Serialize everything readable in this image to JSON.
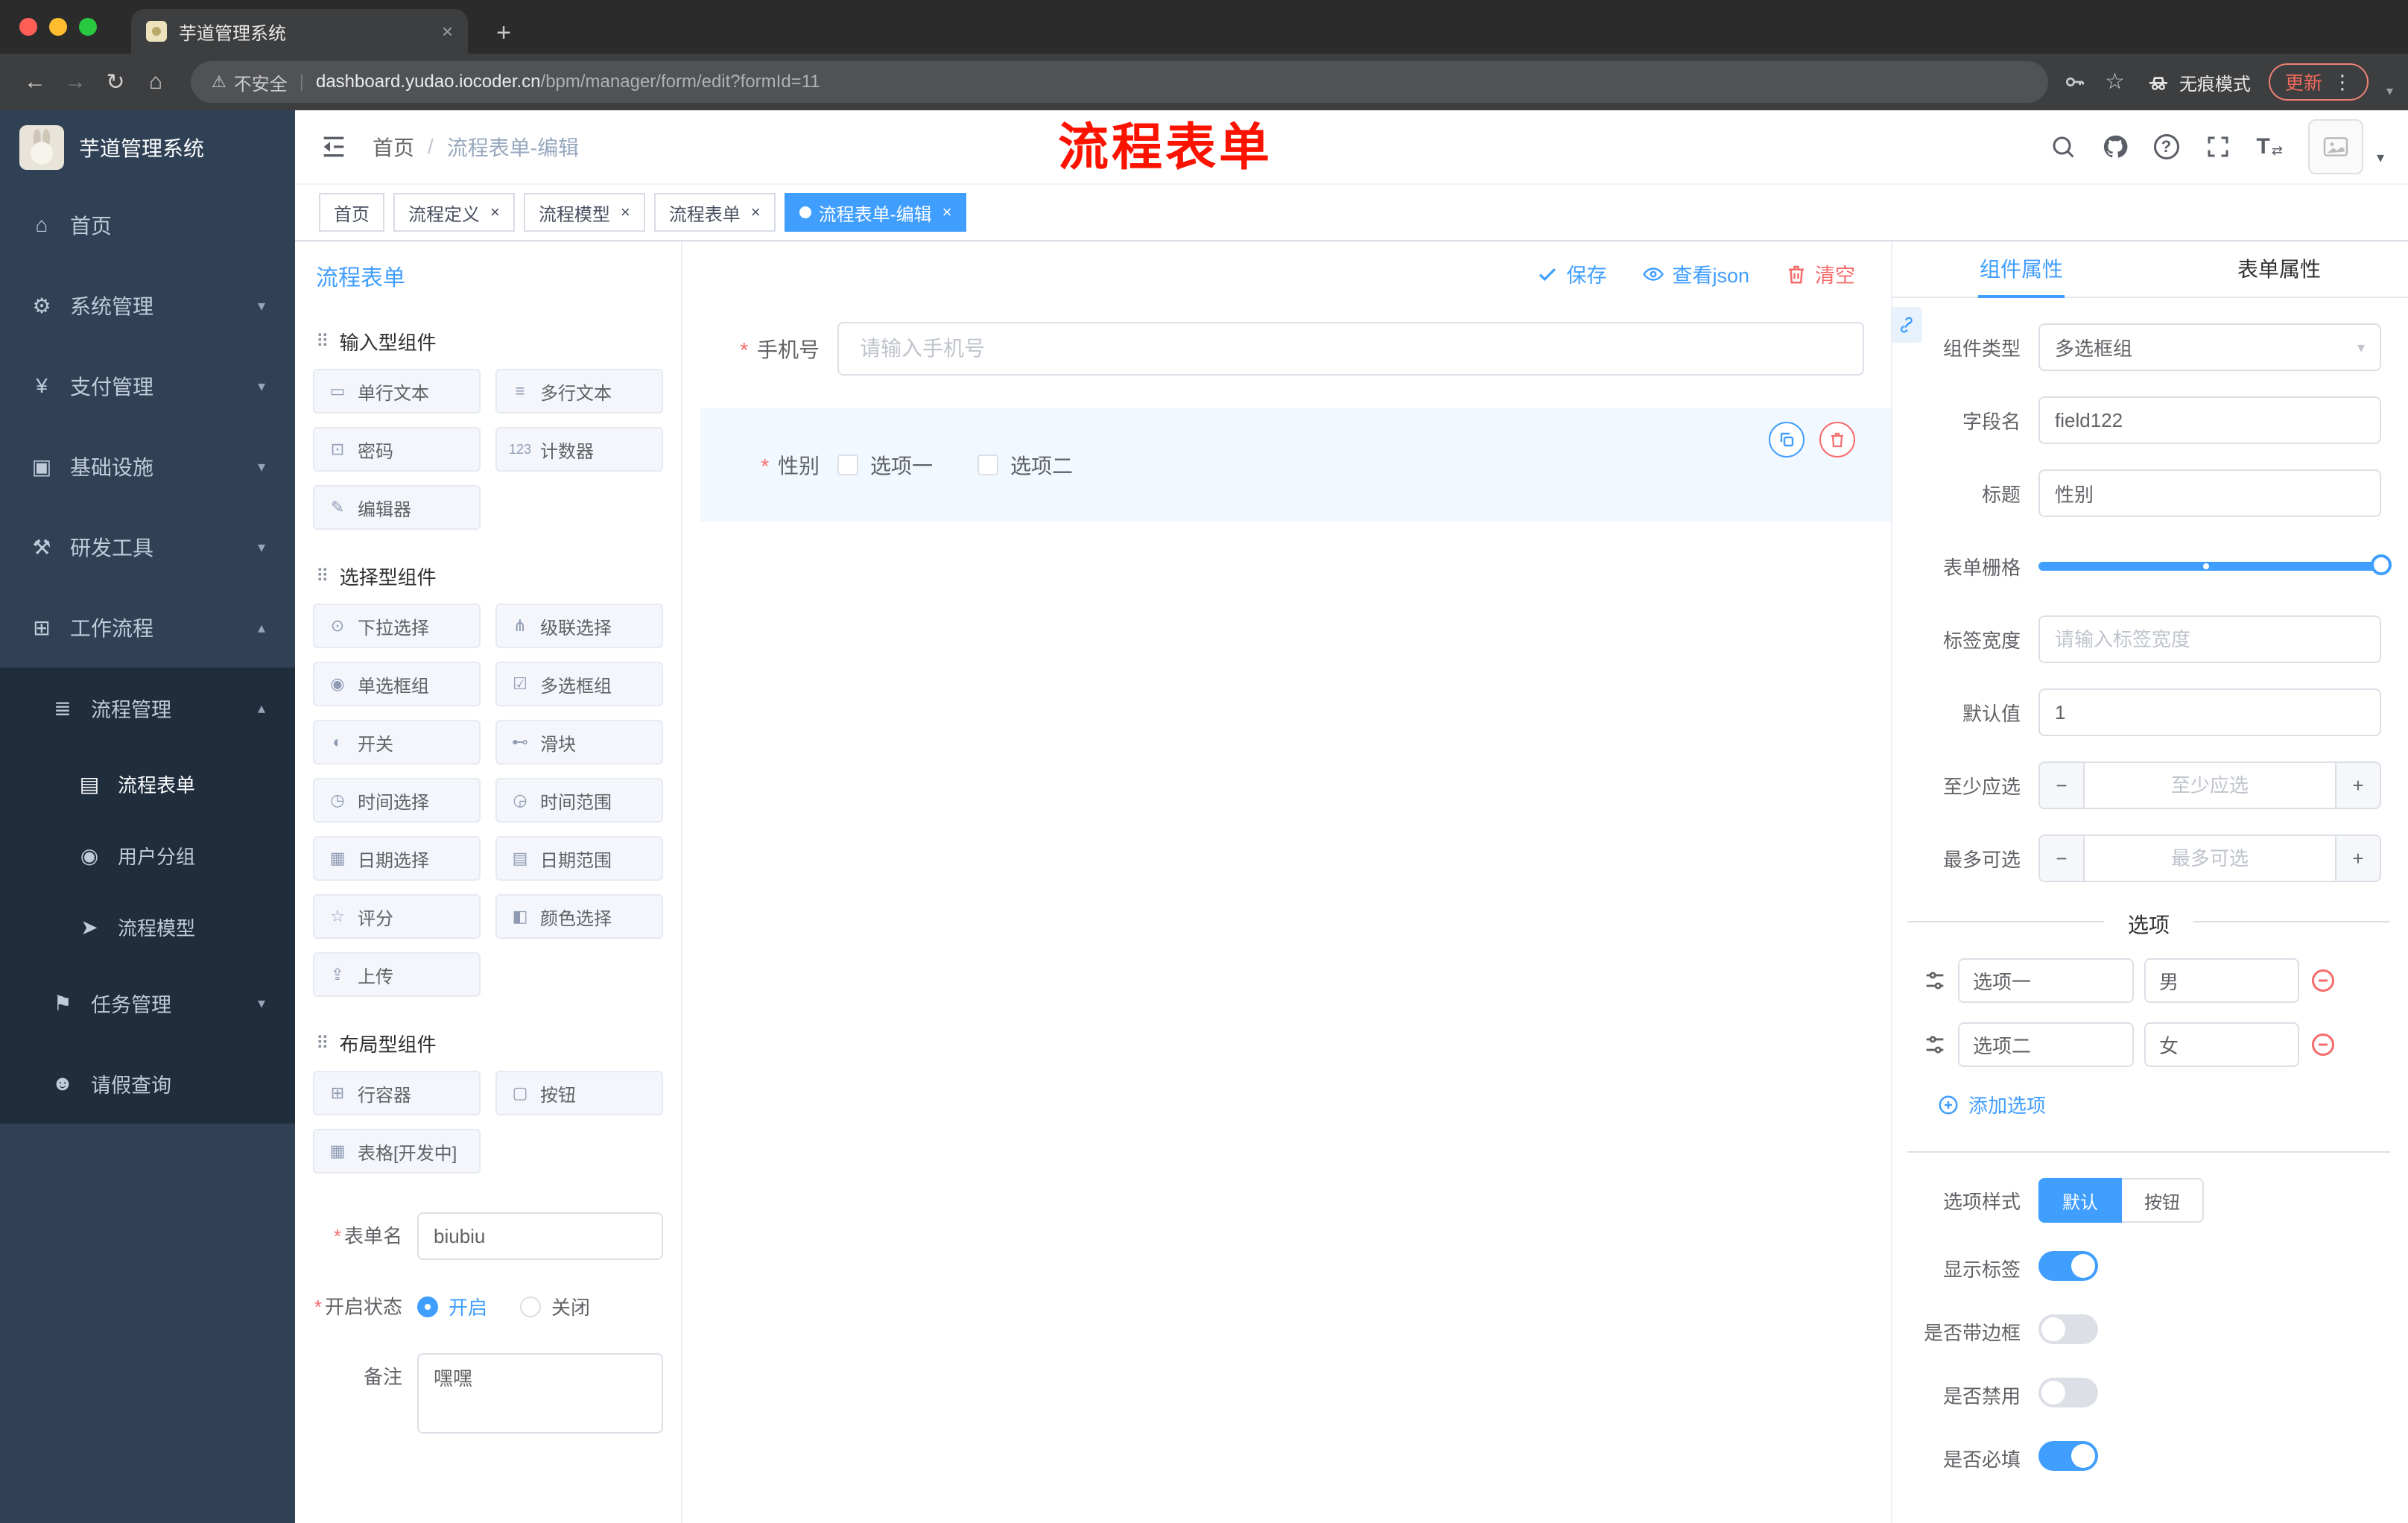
{
  "colors": {
    "accent": "#409eff",
    "danger": "#f56c6c",
    "annotation": "#fb1300",
    "sidebar": "#304156",
    "sidebar_sub": "#1f2d3d"
  },
  "icons": {
    "close": "×",
    "new_tab": "+",
    "back": "←",
    "forward": "→",
    "reload": "↻",
    "browser_home": "⌂",
    "warning": "⚠",
    "star": "☆",
    "menu_dots": "⋮",
    "question": "?",
    "text_size": "T",
    "swap": "⇄",
    "chev_down": "▾",
    "chev_up": "▴",
    "minus": "−",
    "plus": "+",
    "drag": "⠿",
    "home": "⌂",
    "gear": "⚙",
    "yen": "¥",
    "infra": "▣",
    "tools": "⚒",
    "workflow": "⊞",
    "process": "≣",
    "form": "▤",
    "users": "◉",
    "model": "➤",
    "tasks": "⚑",
    "person": "☻",
    "chips": [
      "▭",
      "≡",
      "⊡",
      "123",
      "✎",
      "⊙",
      "⋔",
      "◉",
      "☑",
      "◐",
      "⊷",
      "◷",
      "◶",
      "▦",
      "▤",
      "☆",
      "◧",
      "⇪",
      "⊞",
      "▢",
      "▦"
    ]
  },
  "browser": {
    "tab_title": "芋道管理系统",
    "security_label": "不安全",
    "divider": "|",
    "url_domain": "dashboard.yudao.iocoder.cn",
    "url_path": "/bpm/manager/form/edit?formId=11",
    "incognito_label": "无痕模式",
    "update_label": "更新"
  },
  "sidebar": {
    "brand": "芋道管理系统",
    "items": [
      {
        "label": "首页"
      },
      {
        "label": "系统管理"
      },
      {
        "label": "支付管理"
      },
      {
        "label": "基础设施"
      },
      {
        "label": "研发工具"
      },
      {
        "label": "工作流程"
      },
      {
        "label": "流程管理"
      },
      {
        "label": "流程表单"
      },
      {
        "label": "用户分组"
      },
      {
        "label": "流程模型"
      },
      {
        "label": "任务管理"
      },
      {
        "label": "请假查询"
      }
    ]
  },
  "header": {
    "breadcrumb_home": "首页",
    "breadcrumb_sep": "/",
    "breadcrumb_current": "流程表单-编辑",
    "annotation": "流程表单"
  },
  "tags": [
    {
      "label": "首页"
    },
    {
      "label": "流程定义"
    },
    {
      "label": "流程模型"
    },
    {
      "label": "流程表单"
    },
    {
      "label": "流程表单-编辑"
    }
  ],
  "palette": {
    "title": "流程表单",
    "required_mark": "*",
    "groups": [
      {
        "title": "输入型组件",
        "items": [
          "单行文本",
          "多行文本",
          "密码",
          "计数器",
          "编辑器"
        ]
      },
      {
        "title": "选择型组件",
        "items": [
          "下拉选择",
          "级联选择",
          "单选框组",
          "多选框组",
          "开关",
          "滑块",
          "时间选择",
          "时间范围",
          "日期选择",
          "日期范围",
          "评分",
          "颜色选择",
          "上传"
        ]
      },
      {
        "title": "布局型组件",
        "items": [
          "行容器",
          "按钮",
          "表格[开发中]"
        ]
      }
    ],
    "form_meta": {
      "name_label": "表单名",
      "name_value": "biubiu",
      "status_label": "开启状态",
      "status_on": "开启",
      "status_off": "关闭",
      "remark_label": "备注",
      "remark_value": "嘿嘿"
    }
  },
  "canvas": {
    "save": "保存",
    "view_json": "查看json",
    "clear": "清空",
    "phone_label": "手机号",
    "phone_placeholder": "请输入手机号",
    "gender_label": "性别",
    "gender_options": [
      "选项一",
      "选项二"
    ]
  },
  "props": {
    "tab_component": "组件属性",
    "tab_form": "表单属性",
    "rows": {
      "type_label": "组件类型",
      "type_value": "多选框组",
      "field_label": "字段名",
      "field_value": "field122",
      "title_label": "标题",
      "title_value": "性别",
      "grid_label": "表单栅格",
      "width_label": "标签宽度",
      "width_placeholder": "请输入标签宽度",
      "default_label": "默认值",
      "default_value": "1",
      "min_label": "至少应选",
      "min_placeholder": "至少应选",
      "max_label": "最多可选",
      "max_placeholder": "最多可选"
    },
    "options_title": "选项",
    "options": [
      {
        "label": "选项一",
        "value": "男"
      },
      {
        "label": "选项二",
        "value": "女"
      }
    ],
    "add_option": "添加选项",
    "style_label": "选项样式",
    "style_default": "默认",
    "style_button": "按钮",
    "toggles": [
      {
        "label": "显示标签",
        "on": true
      },
      {
        "label": "是否带边框",
        "on": false
      },
      {
        "label": "是否禁用",
        "on": false
      },
      {
        "label": "是否必填",
        "on": true
      }
    ]
  }
}
